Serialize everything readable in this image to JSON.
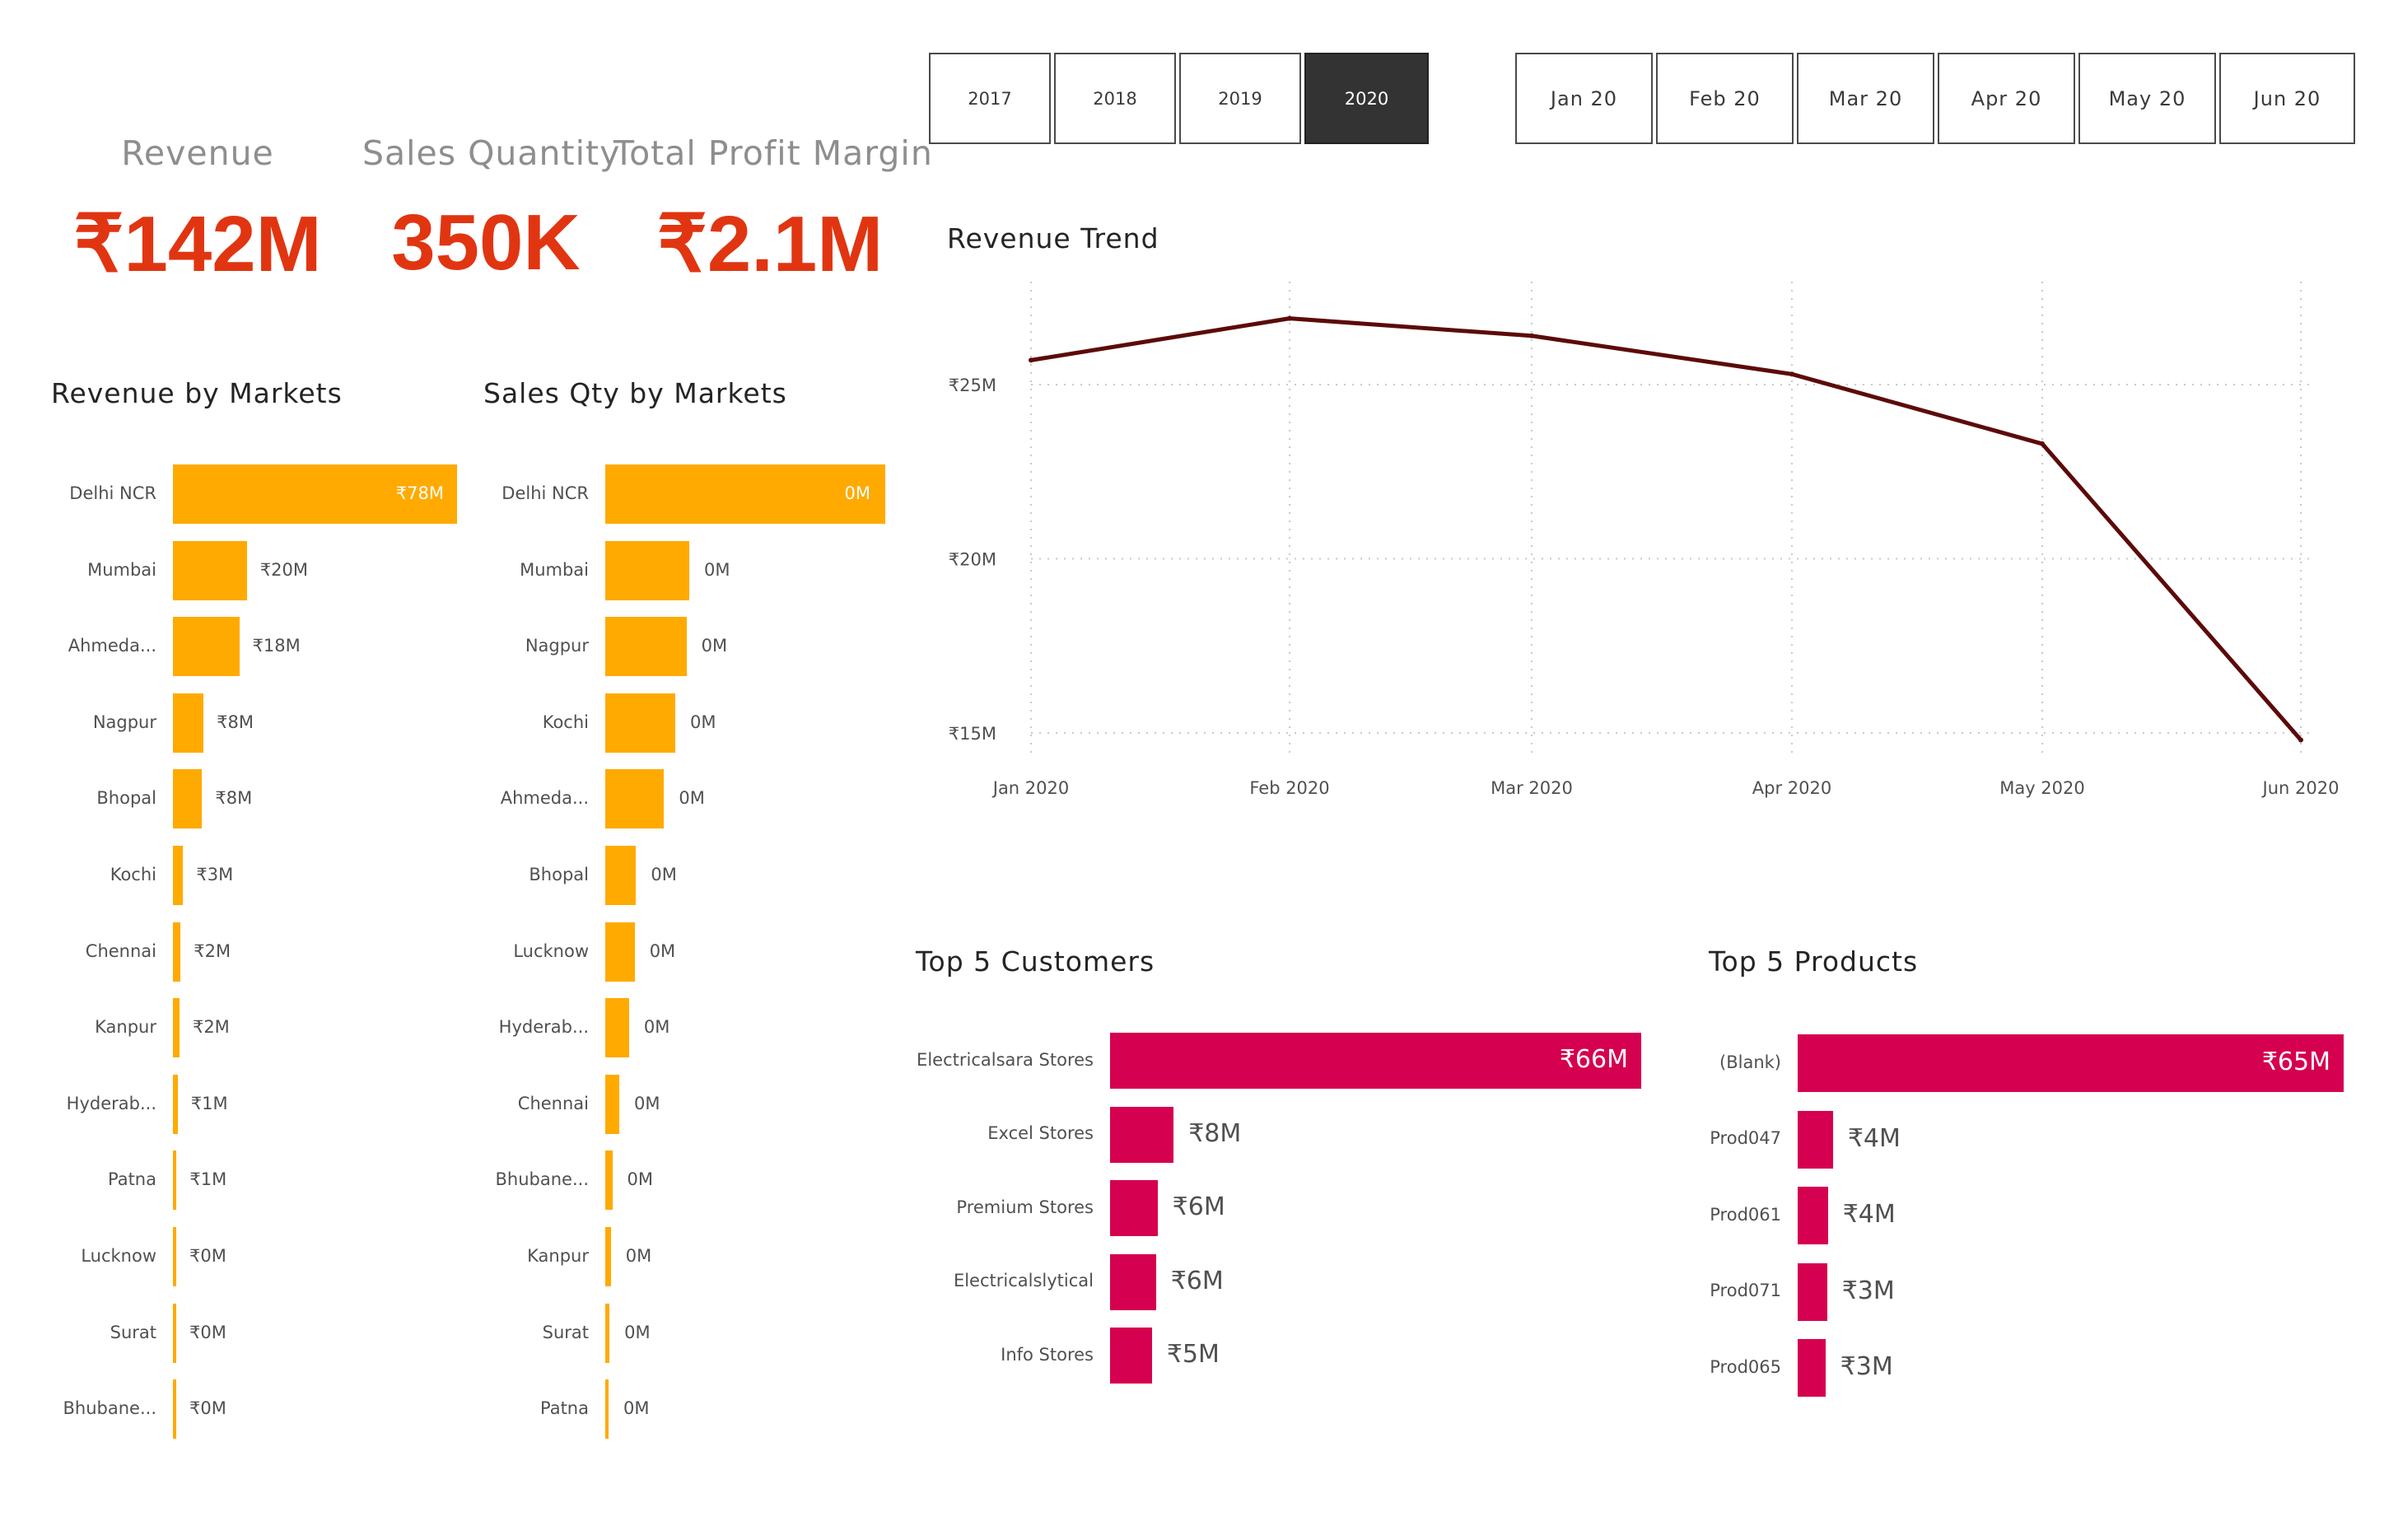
{
  "kpis": [
    {
      "label": "Revenue",
      "value": "₹142M"
    },
    {
      "label": "Sales Quantity",
      "value": "350K"
    },
    {
      "label": "Total Profit Margin",
      "value": "₹2.1M"
    }
  ],
  "year_slicer": {
    "options": [
      "2017",
      "2018",
      "2019",
      "2020"
    ],
    "selected": "2020"
  },
  "month_slicer": {
    "options": [
      "Jan 20",
      "Feb 20",
      "Mar 20",
      "Apr 20",
      "May 20",
      "Jun 20"
    ]
  },
  "colors": {
    "market_bar": "#FFAA00",
    "top5_bar": "#D5004F",
    "trend_line": "#5C0A0A",
    "kpi": "#E13511",
    "selected_slicer": "#333333"
  },
  "revenue_trend": {
    "title": "Revenue Trend",
    "x_labels": [
      "Jan 2020",
      "Feb 2020",
      "Mar 2020",
      "Apr 2020",
      "May 2020",
      "Jun 2020"
    ],
    "y_ticks": [
      "₹25M",
      "₹20M",
      "₹15M"
    ]
  },
  "revenue_by_markets": {
    "title": "Revenue by Markets",
    "labels": [
      "Delhi NCR",
      "Mumbai",
      "Ahmeda...",
      "Nagpur",
      "Bhopal",
      "Kochi",
      "Chennai",
      "Kanpur",
      "Hyderab...",
      "Patna",
      "Lucknow",
      "Surat",
      "Bhubane..."
    ],
    "value_labels": [
      "₹78M",
      "₹20M",
      "₹18M",
      "₹8M",
      "₹8M",
      "₹3M",
      "₹2M",
      "₹2M",
      "₹1M",
      "₹1M",
      "₹0M",
      "₹0M",
      "₹0M"
    ]
  },
  "sales_qty_by_markets": {
    "title": "Sales Qty by Markets",
    "labels": [
      "Delhi NCR",
      "Mumbai",
      "Nagpur",
      "Kochi",
      "Ahmeda...",
      "Bhopal",
      "Lucknow",
      "Hyderab...",
      "Chennai",
      "Bhubane...",
      "Kanpur",
      "Surat",
      "Patna"
    ],
    "value_labels": [
      "0M",
      "0M",
      "0M",
      "0M",
      "0M",
      "0M",
      "0M",
      "0M",
      "0M",
      "0M",
      "0M",
      "0M",
      "0M"
    ]
  },
  "top_customers": {
    "title": "Top 5 Customers",
    "labels": [
      "Electricalsara Stores",
      "Excel Stores",
      "Premium Stores",
      "Electricalslytical",
      "Info Stores"
    ],
    "value_labels": [
      "₹66M",
      "₹8M",
      "₹6M",
      "₹6M",
      "₹5M"
    ]
  },
  "top_products": {
    "title": "Top 5 Products",
    "labels": [
      "(Blank)",
      "Prod047",
      "Prod061",
      "Prod071",
      "Prod065"
    ],
    "value_labels": [
      "₹65M",
      "₹4M",
      "₹4M",
      "₹3M",
      "₹3M"
    ]
  },
  "chart_data": [
    {
      "type": "line",
      "title": "Revenue Trend",
      "x": [
        "Jan 2020",
        "Feb 2020",
        "Mar 2020",
        "Apr 2020",
        "May 2020",
        "Jun 2020"
      ],
      "series": [
        {
          "values": [
            25.7,
            26.9,
            26.4,
            25.3,
            23.3,
            14.8
          ]
        }
      ],
      "ylim": [
        14.5,
        27.5
      ],
      "y_ticks": [
        15,
        20,
        25
      ],
      "grid": true
    },
    {
      "type": "bar",
      "title": "Revenue by Markets",
      "categories": [
        "Delhi NCR",
        "Mumbai",
        "Ahmeda...",
        "Nagpur",
        "Bhopal",
        "Kochi",
        "Chennai",
        "Kanpur",
        "Hyderab...",
        "Patna",
        "Lucknow",
        "Surat",
        "Bhubane..."
      ],
      "values": [
        78,
        20.3,
        18.2,
        8.4,
        8,
        2.8,
        2.1,
        1.8,
        1.3,
        1,
        0.4,
        0.3,
        0.2
      ],
      "orientation": "horizontal"
    },
    {
      "type": "bar",
      "title": "Sales Qty by Markets",
      "categories": [
        "Delhi NCR",
        "Mumbai",
        "Nagpur",
        "Kochi",
        "Ahmeda...",
        "Bhopal",
        "Lucknow",
        "Hyderab...",
        "Chennai",
        "Bhubane...",
        "Kanpur",
        "Surat",
        "Patna"
      ],
      "values": [
        0.2,
        0.06,
        0.058,
        0.05,
        0.042,
        0.022,
        0.021,
        0.017,
        0.01,
        0.005,
        0.004,
        0.003,
        0.002
      ],
      "orientation": "horizontal"
    },
    {
      "type": "bar",
      "title": "Top 5 Customers",
      "categories": [
        "Electricalsara Stores",
        "Excel Stores",
        "Premium Stores",
        "Electricalslytical",
        "Info Stores"
      ],
      "values": [
        66,
        7.9,
        5.9,
        5.7,
        5.2
      ],
      "orientation": "horizontal"
    },
    {
      "type": "bar",
      "title": "Top 5 Products",
      "categories": [
        "(Blank)",
        "Prod047",
        "Prod061",
        "Prod071",
        "Prod065"
      ],
      "values": [
        65,
        4.2,
        3.6,
        3.5,
        3.3
      ],
      "orientation": "horizontal"
    }
  ]
}
